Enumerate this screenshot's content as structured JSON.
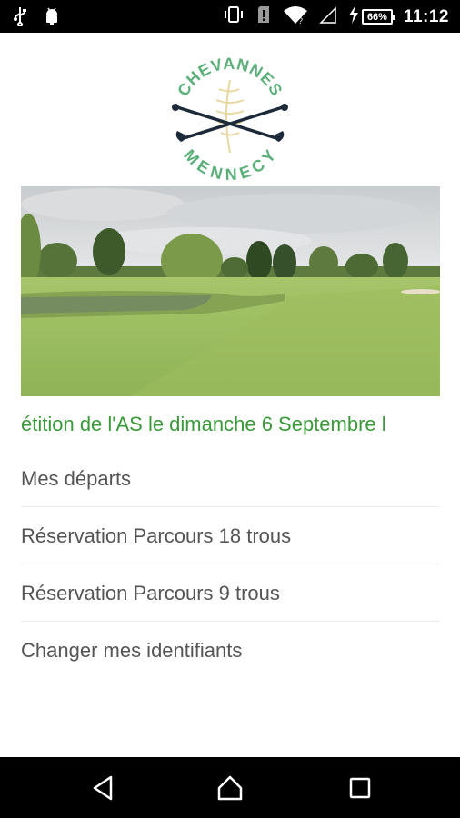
{
  "status_bar": {
    "time": "11:12",
    "battery": "66%",
    "icons": [
      "usb-icon",
      "android-debug-icon",
      "vibrate-icon",
      "sim-alert-icon",
      "wifi-icon",
      "signal-icon",
      "charging-icon"
    ]
  },
  "logo": {
    "top_text": "CHEVANNES",
    "bottom_text": "MENNECY"
  },
  "marquee": {
    "text": "étition de l'AS le dimanche 6 Septembre l"
  },
  "menu": {
    "items": [
      {
        "label": "Mes départs"
      },
      {
        "label": "Réservation Parcours 18 trous"
      },
      {
        "label": "Réservation Parcours 9 trous"
      },
      {
        "label": "Changer mes identifiants"
      }
    ]
  },
  "nav_bar": {
    "icons": [
      "back-icon",
      "home-icon",
      "recents-icon"
    ]
  },
  "colors": {
    "accent_green": "#3a9a3a",
    "logo_green": "#5bb07a",
    "menu_text": "#555555"
  }
}
